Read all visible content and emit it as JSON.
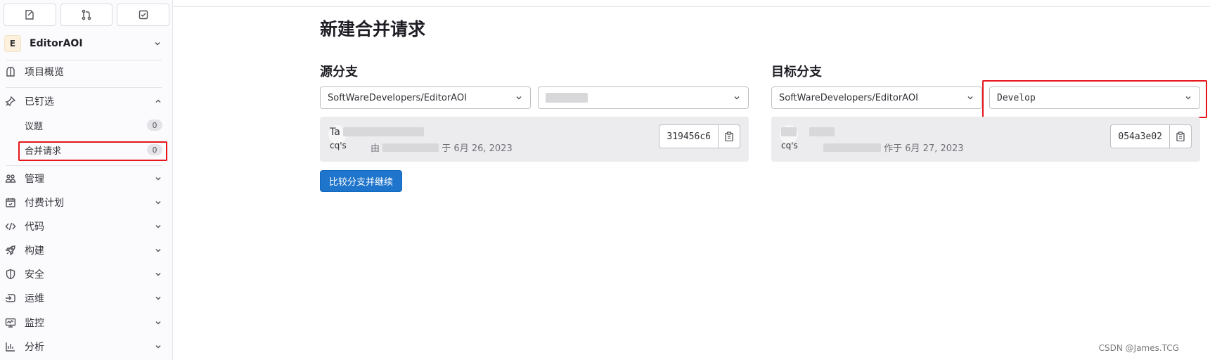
{
  "sidebar": {
    "top_buttons": [
      {
        "icon": "issues-icon"
      },
      {
        "icon": "merge-request-icon"
      },
      {
        "icon": "todo-icon"
      }
    ],
    "project": {
      "avatar_letter": "E",
      "name": "EditorAOI"
    },
    "overview_label": "项目概览",
    "pinned_label": "已钉选",
    "pinned_items": [
      {
        "label": "议题",
        "count": "0"
      },
      {
        "label": "合并请求",
        "count": "0"
      }
    ],
    "menu": [
      {
        "label": "管理",
        "icon": "users-icon"
      },
      {
        "label": "付费计划",
        "icon": "calendar-icon"
      },
      {
        "label": "代码",
        "icon": "code-icon"
      },
      {
        "label": "构建",
        "icon": "rocket-icon"
      },
      {
        "label": "安全",
        "icon": "shield-icon"
      },
      {
        "label": "运维",
        "icon": "deployments-icon"
      },
      {
        "label": "监控",
        "icon": "monitor-icon"
      },
      {
        "label": "分析",
        "icon": "chart-icon"
      }
    ]
  },
  "main": {
    "title": "新建合并请求",
    "source": {
      "heading": "源分支",
      "project": "SoftWareDevelopers/EditorAOI",
      "branch": "",
      "commit": {
        "title": "Ta",
        "author": "cq's",
        "meta_prefix": "由",
        "meta_suffix": "于 6月 26, 2023",
        "sha": "319456c6"
      }
    },
    "target": {
      "heading": "目标分支",
      "project": "SoftWareDevelopers/EditorAOI",
      "branch": "Develop",
      "commit": {
        "title": "",
        "author": "cq's",
        "meta_prefix": "",
        "meta_suffix": "作于 6月 27, 2023",
        "sha": "054a3e02"
      }
    },
    "compare_button": "比较分支并继续"
  },
  "watermark": "CSDN @James.TCG",
  "colors": {
    "primary": "#1f75cb",
    "highlight": "#e5161b",
    "sidebar_bg": "#fbfafd",
    "commit_bg": "#ececef"
  }
}
